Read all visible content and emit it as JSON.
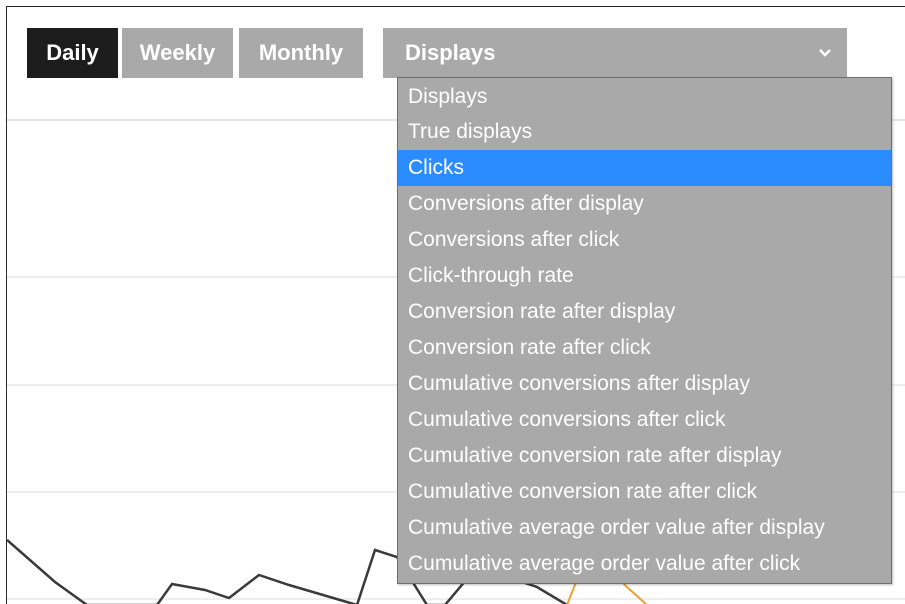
{
  "period_tabs": [
    {
      "label": "Daily",
      "active": true
    },
    {
      "label": "Weekly",
      "active": false
    },
    {
      "label": "Monthly",
      "active": false
    }
  ],
  "metric_select": {
    "value": "Displays",
    "icon": "chevron-down-icon",
    "options": [
      "Displays",
      "True displays",
      "Clicks",
      "Conversions after display",
      "Conversions after click",
      "Click-through rate",
      "Conversion rate after display",
      "Conversion rate after click",
      "Cumulative conversions after display",
      "Cumulative conversions after click",
      "Cumulative conversion rate after display",
      "Cumulative conversion rate after click",
      "Cumulative average order value after display",
      "Cumulative average order value after click"
    ],
    "highlighted_index": 2
  },
  "colors": {
    "active_tab": "#1d1d1d",
    "inactive_tab": "#a9a9a9",
    "dropdown_bg": "#a9a9a9",
    "highlight": "#2a8cff",
    "series_line": "#3a3a3a",
    "series_accent": "#f0a030",
    "gridline": "#dddddd"
  }
}
